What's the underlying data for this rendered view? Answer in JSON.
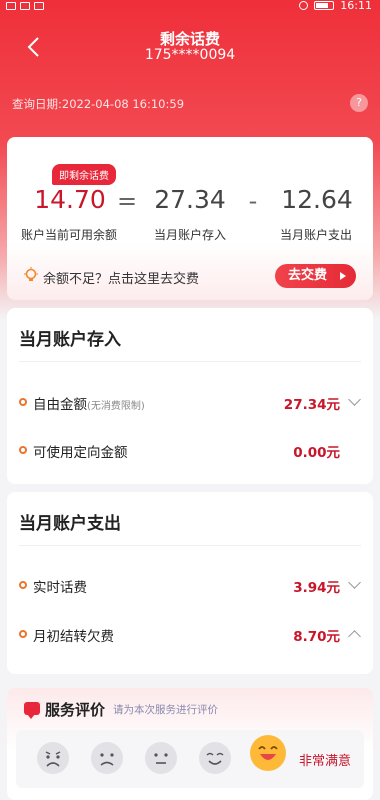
{
  "statusbar": {
    "time": "16:11"
  },
  "header": {
    "back_icon": "chevron-left-icon",
    "title": "剩余话费",
    "phone": "175****0094",
    "query_date": "查询日期:2022-04-08 16:10:59",
    "help_symbol": "?"
  },
  "balance": {
    "badge": "即剩余话费",
    "current": "14.70",
    "equals": "=",
    "income": "27.34",
    "minus": "-",
    "expense": "12.64",
    "current_label": "账户当前可用余额",
    "income_label": "当月账户存入",
    "expense_label": "当月账户支出",
    "tip": "余额不足？点击这里去交费",
    "pay_button": "去交费"
  },
  "income": {
    "title": "当月账户存入",
    "rows": [
      {
        "label": "自由金额",
        "note": "(无消费限制)",
        "value": "27.34元"
      },
      {
        "label": "可使用定向金额",
        "note": "",
        "value": "0.00元"
      }
    ]
  },
  "expense": {
    "title": "当月账户支出",
    "rows": [
      {
        "label": "实时话费",
        "value": "3.94元"
      },
      {
        "label": "月初结转欠费",
        "value": "8.70元"
      }
    ]
  },
  "evaluation": {
    "title": "服务评价",
    "hint": "请为本次服务进行评价",
    "selected_label": "非常满意",
    "faces": [
      "very-unsatisfied-face-icon",
      "unsatisfied-face-icon",
      "neutral-face-icon",
      "satisfied-face-icon",
      "very-satisfied-face-icon"
    ]
  },
  "colors": {
    "brand_red": "#e8283a",
    "amount_red": "#c8162a",
    "dot_orange": "#e8762d"
  }
}
